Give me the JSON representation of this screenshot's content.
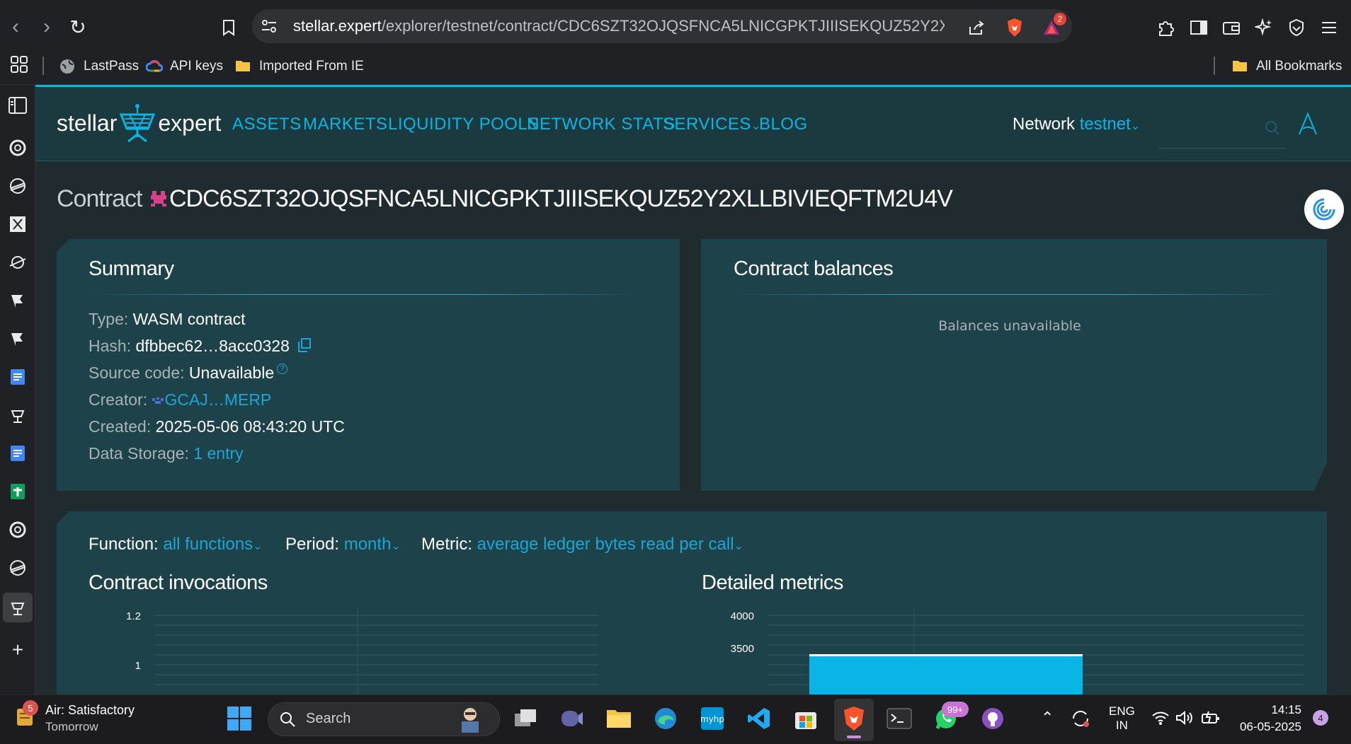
{
  "browser": {
    "url_host": "stellar.expert",
    "url_path": "/explorer/testnet/contract/CDC6SZT32OJQSFNCA5LNICGPKTJIIISEKQUZ52Y2XLLBIVIE...",
    "notification_count": "2",
    "bookmarks": [
      "LastPass",
      "API keys",
      "Imported From IE"
    ],
    "all_bookmarks_label": "All Bookmarks"
  },
  "site": {
    "logo_left": "stellar",
    "logo_right": "expert",
    "nav": [
      "ASSETS",
      "MARKETS",
      "LIQUIDITY POOLS",
      "NETWORK STATS",
      "SERVICES",
      "BLOG"
    ],
    "network_label": "Network",
    "network_value": "testnet"
  },
  "contract": {
    "title_prefix": "Contract",
    "id": "CDC6SZT32OJQSFNCA5LNICGPKTJIIISEKQUZ52Y2XLLBIVIEQFTM2U4V"
  },
  "summary": {
    "title": "Summary",
    "type_label": "Type:",
    "type_value": "WASM contract",
    "hash_label": "Hash:",
    "hash_value": "dfbbec62…8acc0328",
    "source_label": "Source code:",
    "source_value": "Unavailable",
    "source_help": "?",
    "creator_label": "Creator:",
    "creator_value": "GCAJ…MERP",
    "created_label": "Created:",
    "created_value": "2025-05-06 08:43:20 UTC",
    "storage_label": "Data Storage:",
    "storage_value": "1 entry"
  },
  "balances": {
    "title": "Contract balances",
    "empty_text": "Balances unavailable"
  },
  "filters": {
    "function_label": "Function:",
    "function_value": "all functions",
    "period_label": "Period:",
    "period_value": "month",
    "metric_label": "Metric:",
    "metric_value": "average ledger bytes read per call"
  },
  "chart_data": [
    {
      "type": "line",
      "title": "Contract invocations",
      "y_ticks": [
        "1.2",
        "1"
      ]
    },
    {
      "type": "bar",
      "title": "Detailed metrics",
      "y_ticks": [
        "4000",
        "3500"
      ],
      "values": [
        3500
      ]
    }
  ],
  "taskbar": {
    "weather_badge": "5",
    "weather_title": "Air: Satisfactory",
    "weather_sub": "Tomorrow",
    "search_placeholder": "Search",
    "whatsapp_badge": "99+",
    "lang_top": "ENG",
    "lang_bottom": "IN",
    "time": "14:15",
    "date": "06-05-2025",
    "notif_badge": "4"
  },
  "colors": {
    "accent": "#08b5e5",
    "card": "#1e4249",
    "header": "#1b3a40",
    "background": "#1f2b2f"
  }
}
